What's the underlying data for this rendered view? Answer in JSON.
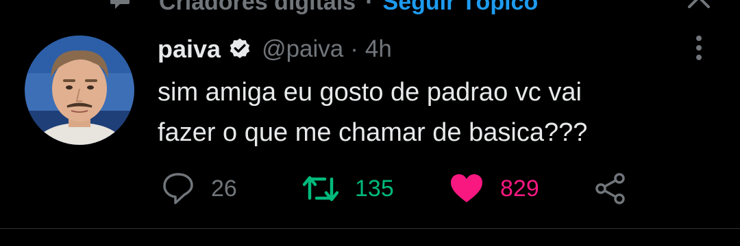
{
  "context": {
    "topic_text": "Criadores digitais",
    "separator": "·",
    "follow_topic_label": "Seguir Tópico"
  },
  "tweet": {
    "author_name": "paiva",
    "handle": "@paiva",
    "separator": "·",
    "time": "4h",
    "text_line1": "sim amiga eu gosto de padrao vc vai",
    "text_line2": "fazer o que me chamar de basica???"
  },
  "actions": {
    "reply_count": "26",
    "retweet_count": "135",
    "like_count": "829"
  },
  "colors": {
    "background": "#000000",
    "text_primary": "#e7e9ea",
    "text_secondary": "#71767b",
    "link": "#1d9bf0",
    "retweet_active": "#00ba7c",
    "like_active": "#f91880"
  },
  "icons": {
    "context": "speech-bubble-icon",
    "close": "close-icon",
    "verified": "verified-badge-icon",
    "more": "more-vertical-icon",
    "reply": "reply-icon",
    "retweet": "retweet-icon",
    "like": "heart-icon",
    "share": "share-icon"
  }
}
